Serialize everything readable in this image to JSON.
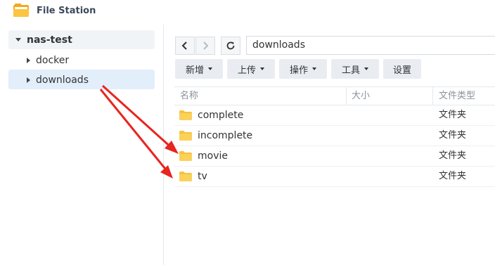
{
  "window": {
    "title": "File Station"
  },
  "sidebar": {
    "root": "nas-test",
    "items": [
      {
        "label": "docker"
      },
      {
        "label": "downloads"
      }
    ]
  },
  "toolbar": {
    "path": "downloads",
    "buttons": [
      {
        "label": "新增"
      },
      {
        "label": "上传"
      },
      {
        "label": "操作"
      },
      {
        "label": "工具"
      },
      {
        "label": "设置"
      }
    ]
  },
  "table": {
    "columns": [
      "名称",
      "大小",
      "文件类型"
    ],
    "rows": [
      {
        "name": "complete",
        "type": "文件夹"
      },
      {
        "name": "incomplete",
        "type": "文件夹"
      },
      {
        "name": "movie",
        "type": "文件夹"
      },
      {
        "name": "tv",
        "type": "文件夹"
      }
    ]
  },
  "colors": {
    "selection": "#e3eefb",
    "folder": "#f7c23c",
    "annotation_arrow": "#e8251f"
  }
}
